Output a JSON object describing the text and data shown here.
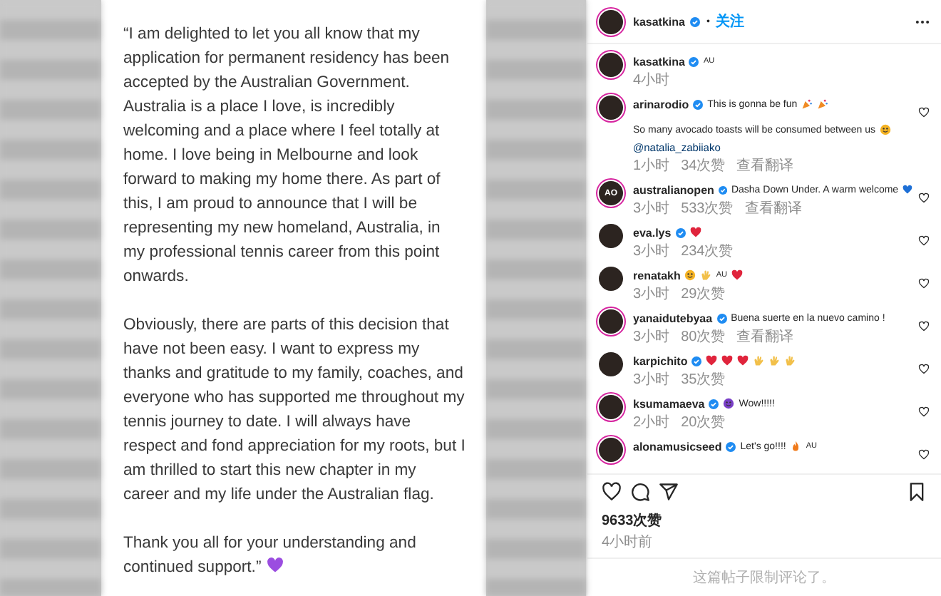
{
  "post": {
    "paragraphs": [
      "“I am delighted to let you all know that my application for permanent residency has been accepted by the Australian Government. Australia is a place I love,  is incredibly welcoming and a place where I feel totally at home. I love being in Melbourne and look forward to making my home there. As part of this, I am proud to announce that I will be representing my new homeland, Australia, in my professional tennis career from this point onwards.",
      "Obviously, there are parts of this decision that have not been easy. I want to express my thanks and gratitude to my family, coaches, and everyone who has supported me throughout my tennis journey to date. I will always have respect and fond appreciation for my roots, but I am thrilled to start this new chapter in my career and my life under the Australian flag.",
      "Thank you all for your understanding and continued support.”"
    ],
    "end_emoji": {
      "kind": "heart",
      "color": "#9b4de0"
    }
  },
  "header": {
    "username": "kasatkina",
    "verified": true,
    "separator": "•",
    "follow": "关注"
  },
  "comments": [
    {
      "username": "kasatkina",
      "verified": true,
      "ring": true,
      "parts": [
        {
          "kind": "flag",
          "text": "AU"
        }
      ],
      "meta": [
        "4小时"
      ],
      "like": false
    },
    {
      "username": "arinarodio",
      "verified": true,
      "ring": true,
      "parts": [
        {
          "kind": "text",
          "text": "This is gonna be fun"
        },
        {
          "kind": "party",
          "color": "#f08a24"
        },
        {
          "kind": "party",
          "color": "#f08a24"
        }
      ],
      "extra": [
        {
          "kind": "text",
          "text": "So many avocado toasts will be consumed between us"
        },
        {
          "kind": "face",
          "color": "#f5b324"
        }
      ],
      "mention": "@natalia_zabiiako",
      "meta": [
        "1小时",
        "34次赞",
        "查看翻译"
      ],
      "like": true
    },
    {
      "username": "australianopen",
      "verified": true,
      "ring": true,
      "avatar_text": "AO",
      "parts": [
        {
          "kind": "text",
          "text": "Dasha Down Under. A warm welcome"
        },
        {
          "kind": "heart",
          "color": "#1d6fd6"
        }
      ],
      "meta": [
        "3小时",
        "533次赞",
        "查看翻译"
      ],
      "like": true
    },
    {
      "username": "eva.lys",
      "verified": true,
      "ring": false,
      "parts": [
        {
          "kind": "heart",
          "color": "#e0243c"
        }
      ],
      "meta": [
        "3小时",
        "234次赞"
      ],
      "like": true
    },
    {
      "username": "renatakh",
      "verified": false,
      "ring": false,
      "parts": [
        {
          "kind": "face",
          "color": "#f5b324"
        },
        {
          "kind": "hand",
          "color": "#f2c04a"
        },
        {
          "kind": "flag",
          "text": "AU"
        },
        {
          "kind": "heart",
          "color": "#e0243c"
        }
      ],
      "meta": [
        "3小时",
        "29次赞"
      ],
      "like": true
    },
    {
      "username": "yanaidutebyaa",
      "verified": true,
      "ring": true,
      "parts": [
        {
          "kind": "text",
          "text": "Buena suerte en la nuevo camino !"
        }
      ],
      "meta": [
        "3小时",
        "80次赞",
        "查看翻译"
      ],
      "like": true
    },
    {
      "username": "karpichito",
      "verified": true,
      "ring": false,
      "parts": [
        {
          "kind": "heart",
          "color": "#e0243c"
        },
        {
          "kind": "heart",
          "color": "#e0243c"
        },
        {
          "kind": "heart",
          "color": "#e0243c"
        },
        {
          "kind": "hand",
          "color": "#f2c04a"
        },
        {
          "kind": "hand",
          "color": "#f2c04a"
        },
        {
          "kind": "hand",
          "color": "#f2c04a"
        }
      ],
      "meta": [
        "3小时",
        "35次赞"
      ],
      "like": true
    },
    {
      "username": "ksumamaeva",
      "verified": true,
      "ring": true,
      "parts": [
        {
          "kind": "face",
          "color": "#7a3fc8"
        },
        {
          "kind": "text",
          "text": "Wow!!!!!"
        }
      ],
      "meta": [
        "2小时",
        "20次赞"
      ],
      "like": true
    },
    {
      "username": "alonamusicseed",
      "verified": true,
      "ring": true,
      "parts": [
        {
          "kind": "text",
          "text": "Let's go!!!!"
        },
        {
          "kind": "flame",
          "color": "#f07a1a"
        },
        {
          "kind": "flag",
          "text": "AU"
        }
      ],
      "like": true
    }
  ],
  "likes": "9633次赞",
  "time": "4小时前",
  "comment_notice": "这篇帖子限制评论了。"
}
